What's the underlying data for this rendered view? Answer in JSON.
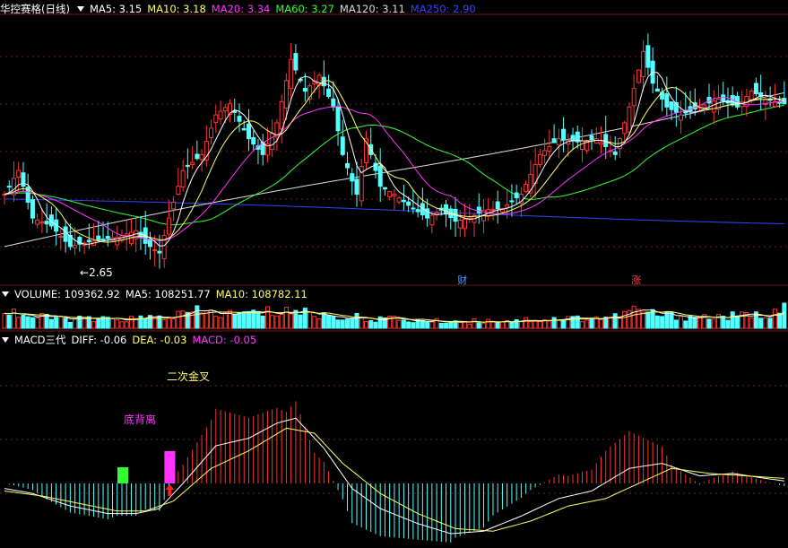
{
  "stock": {
    "name": "华控赛格",
    "period": "(日线)"
  },
  "price_panel": {
    "ma_labels": [
      {
        "text": "MA5: 3.15",
        "color": "#ffffff"
      },
      {
        "text": "MA10: 3.18",
        "color": "#ffff66"
      },
      {
        "text": "MA20: 3.34",
        "color": "#ff33ff"
      },
      {
        "text": "MA60: 3.27",
        "color": "#33ff33"
      },
      {
        "text": "MA120: 3.11",
        "color": "#dddddd"
      },
      {
        "text": "MA250: 2.90",
        "color": "#3344ff"
      }
    ],
    "low_marker": "2.65",
    "tags": [
      {
        "text": "财",
        "color": "#5599ff",
        "bar": 97
      },
      {
        "text": "涨",
        "color": "#ff4444",
        "bar": 134
      }
    ]
  },
  "volume_panel": {
    "labels": [
      {
        "text": "VOLUME: 109362.92",
        "color": "#ffffff"
      },
      {
        "text": "MA5: 108251.77",
        "color": "#ffffff"
      },
      {
        "text": "MA10: 108782.11",
        "color": "#ffff66"
      }
    ]
  },
  "macd_panel": {
    "labels": [
      {
        "text": "MACD三代",
        "color": "#ffffff"
      },
      {
        "text": "DIFF: -0.06",
        "color": "#ffffff"
      },
      {
        "text": "DEA: -0.03",
        "color": "#ffff66"
      },
      {
        "text": "MACD: -0.05",
        "color": "#ff33ff"
      }
    ],
    "annotations": [
      {
        "text": "二次金叉",
        "color": "#ffff66"
      },
      {
        "text": "底背离",
        "color": "#ff33ff"
      }
    ]
  },
  "chart_data": {
    "type": "candlestick",
    "bars": 167,
    "close_anchors": [
      [
        0,
        3.05
      ],
      [
        3,
        3.2
      ],
      [
        6,
        2.9
      ],
      [
        10,
        2.85
      ],
      [
        14,
        2.72
      ],
      [
        18,
        2.75
      ],
      [
        24,
        2.78
      ],
      [
        28,
        2.82
      ],
      [
        30,
        2.74
      ],
      [
        33,
        2.68
      ],
      [
        35,
        2.9
      ],
      [
        38,
        3.2
      ],
      [
        42,
        3.3
      ],
      [
        45,
        3.55
      ],
      [
        48,
        3.62
      ],
      [
        52,
        3.4
      ],
      [
        55,
        3.3
      ],
      [
        58,
        3.5
      ],
      [
        61,
        3.9
      ],
      [
        64,
        3.7
      ],
      [
        67,
        3.8
      ],
      [
        70,
        3.6
      ],
      [
        72,
        3.3
      ],
      [
        75,
        3.05
      ],
      [
        77,
        3.4
      ],
      [
        80,
        3.1
      ],
      [
        83,
        3.05
      ],
      [
        86,
        2.98
      ],
      [
        90,
        2.9
      ],
      [
        93,
        2.95
      ],
      [
        96,
        2.88
      ],
      [
        99,
        2.9
      ],
      [
        102,
        2.95
      ],
      [
        106,
        2.96
      ],
      [
        110,
        3.05
      ],
      [
        114,
        3.3
      ],
      [
        118,
        3.4
      ],
      [
        122,
        3.38
      ],
      [
        126,
        3.4
      ],
      [
        130,
        3.3
      ],
      [
        133,
        3.6
      ],
      [
        136,
        3.95
      ],
      [
        138,
        3.75
      ],
      [
        141,
        3.6
      ],
      [
        144,
        3.55
      ],
      [
        148,
        3.6
      ],
      [
        152,
        3.65
      ],
      [
        156,
        3.6
      ],
      [
        159,
        3.7
      ],
      [
        162,
        3.65
      ],
      [
        166,
        3.62
      ]
    ],
    "volume_anchors": [
      [
        0,
        1.3
      ],
      [
        6,
        0.8
      ],
      [
        12,
        0.7
      ],
      [
        20,
        0.6
      ],
      [
        30,
        0.7
      ],
      [
        36,
        0.9
      ],
      [
        42,
        1.2
      ],
      [
        47,
        1.0
      ],
      [
        55,
        1.1
      ],
      [
        60,
        1.3
      ],
      [
        66,
        1.0
      ],
      [
        72,
        0.8
      ],
      [
        80,
        0.7
      ],
      [
        90,
        0.5
      ],
      [
        100,
        0.5
      ],
      [
        110,
        0.6
      ],
      [
        120,
        0.7
      ],
      [
        130,
        0.8
      ],
      [
        134,
        1.3
      ],
      [
        140,
        0.9
      ],
      [
        150,
        0.8
      ],
      [
        160,
        0.9
      ],
      [
        166,
        1.4
      ]
    ],
    "macd_diff_anchors": [
      [
        0,
        -0.02
      ],
      [
        6,
        -0.04
      ],
      [
        14,
        -0.09
      ],
      [
        22,
        -0.12
      ],
      [
        28,
        -0.12
      ],
      [
        33,
        -0.1
      ],
      [
        38,
        0.0
      ],
      [
        45,
        0.15
      ],
      [
        52,
        0.18
      ],
      [
        58,
        0.24
      ],
      [
        62,
        0.26
      ],
      [
        68,
        0.14
      ],
      [
        74,
        -0.02
      ],
      [
        80,
        -0.1
      ],
      [
        88,
        -0.16
      ],
      [
        95,
        -0.2
      ],
      [
        102,
        -0.19
      ],
      [
        110,
        -0.13
      ],
      [
        118,
        -0.06
      ],
      [
        125,
        -0.03
      ],
      [
        133,
        0.06
      ],
      [
        140,
        0.08
      ],
      [
        148,
        0.03
      ],
      [
        155,
        0.04
      ],
      [
        162,
        0.02
      ],
      [
        166,
        0.01
      ]
    ],
    "macd_dea_anchors": [
      [
        0,
        -0.03
      ],
      [
        8,
        -0.05
      ],
      [
        16,
        -0.08
      ],
      [
        24,
        -0.11
      ],
      [
        30,
        -0.11
      ],
      [
        36,
        -0.07
      ],
      [
        44,
        0.06
      ],
      [
        52,
        0.13
      ],
      [
        60,
        0.22
      ],
      [
        66,
        0.2
      ],
      [
        72,
        0.08
      ],
      [
        80,
        -0.04
      ],
      [
        88,
        -0.12
      ],
      [
        96,
        -0.18
      ],
      [
        104,
        -0.19
      ],
      [
        112,
        -0.15
      ],
      [
        120,
        -0.09
      ],
      [
        128,
        -0.06
      ],
      [
        135,
        0.0
      ],
      [
        142,
        0.06
      ],
      [
        150,
        0.04
      ],
      [
        158,
        0.03
      ],
      [
        166,
        0.02
      ]
    ],
    "ma_periods": [
      5,
      10,
      20,
      60,
      120,
      250
    ],
    "macd_signal_bars": [
      {
        "bar": 25,
        "color": "#33ff33",
        "role": "green-block"
      },
      {
        "bar": 35,
        "color": "#ff33ff",
        "role": "magenta-block"
      }
    ]
  }
}
